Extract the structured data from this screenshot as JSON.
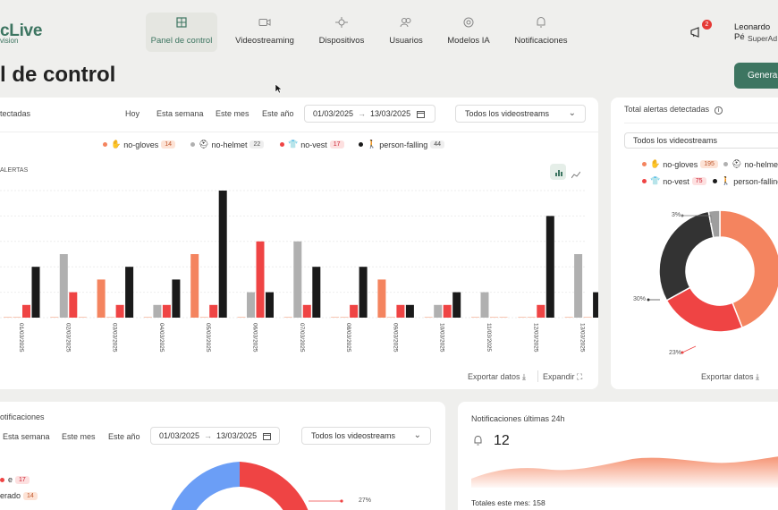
{
  "app": {
    "logo_text": "cLive",
    "logo_sub": "vision"
  },
  "nav": [
    {
      "label": "Panel de control",
      "icon": "dashboard-icon",
      "active": true
    },
    {
      "label": "Videostreaming",
      "icon": "video-camera-icon"
    },
    {
      "label": "Dispositivos",
      "icon": "devices-icon"
    },
    {
      "label": "Usuarios",
      "icon": "users-icon"
    },
    {
      "label": "Modelos IA",
      "icon": "ai-model-icon"
    },
    {
      "label": "Notificaciones",
      "icon": "bell-icon"
    }
  ],
  "header": {
    "notification_count": "2",
    "user_name": "Leonardo Pé",
    "user_role": "SuperAd",
    "page_title": "l de control",
    "generate_button": "Generar"
  },
  "alerts_card": {
    "title": "tectadas",
    "filters": [
      "Hoy",
      "Esta semana",
      "Este mes",
      "Este año"
    ],
    "date_from": "01/03/2025",
    "date_to": "13/03/2025",
    "stream_select": "Todos los videostreams",
    "axis_label": "ALERTAS",
    "legend": [
      {
        "name": "no-gloves",
        "count": "14",
        "color": "#f4845f"
      },
      {
        "name": "no-helmet",
        "count": "22",
        "color": "#b0b0b0"
      },
      {
        "name": "no-vest",
        "count": "17",
        "color": "#ef4444"
      },
      {
        "name": "person-falling",
        "count": "44",
        "color": "#1a1a1a"
      }
    ],
    "export": "Exportar datos",
    "expand": "Expandir"
  },
  "chart_data": {
    "type": "bar",
    "categories": [
      "01/03/2025",
      "02/03/2025",
      "03/03/2025",
      "04/03/2025",
      "05/03/2025",
      "06/03/2025",
      "07/03/2025",
      "08/03/2025",
      "09/03/2025",
      "10/03/2025",
      "11/03/2025",
      "12/03/2025",
      "13/03/2025"
    ],
    "series": [
      {
        "name": "no-gloves",
        "color": "#f4845f",
        "values": [
          0,
          0,
          3,
          0,
          5,
          0,
          0,
          0,
          3,
          0,
          0,
          0,
          0
        ]
      },
      {
        "name": "no-helmet",
        "color": "#b0b0b0",
        "values": [
          0,
          5,
          0,
          1,
          0,
          2,
          6,
          0,
          0,
          1,
          2,
          0,
          5
        ]
      },
      {
        "name": "no-vest",
        "color": "#ef4444",
        "values": [
          1,
          2,
          1,
          1,
          1,
          6,
          1,
          1,
          1,
          1,
          0,
          1,
          0
        ]
      },
      {
        "name": "person-falling",
        "color": "#1a1a1a",
        "values": [
          4,
          0,
          4,
          3,
          10,
          2,
          4,
          4,
          1,
          2,
          0,
          8,
          2
        ]
      }
    ],
    "ylim": [
      0,
      10
    ]
  },
  "total_card": {
    "title": "Total alertas detectadas",
    "stream_select": "Todos los videostreams",
    "legend": [
      {
        "name": "no-gloves",
        "count": "195",
        "color": "#f4845f"
      },
      {
        "name": "no-helmet",
        "count": "",
        "color": "#b0b0b0"
      },
      {
        "name": "no-vest",
        "count": "75",
        "color": "#ef4444"
      },
      {
        "name": "person-falling",
        "count": "",
        "color": "#1a1a1a"
      }
    ],
    "donut_labels": {
      "grey": "3%",
      "black": "30%",
      "red": "23%"
    },
    "export": "Exportar datos"
  },
  "donut_data": {
    "no-gloves": 44,
    "no-vest": 23,
    "person-falling": 30,
    "no-helmet": 3
  },
  "notif_card": {
    "title": "otificaciones",
    "filters": [
      "Esta semana",
      "Este mes",
      "Este año"
    ],
    "date_from": "01/03/2025",
    "date_to": "13/03/2025",
    "stream_select": "Todos los videostreams",
    "legend": [
      {
        "name": "e",
        "count": "17"
      },
      {
        "name": "erado",
        "count": "14"
      }
    ],
    "donut_label": "27%"
  },
  "last24_card": {
    "title": "Notificaciones últimas 24h",
    "count": "12",
    "month_total": "Totales este mes: 158"
  }
}
